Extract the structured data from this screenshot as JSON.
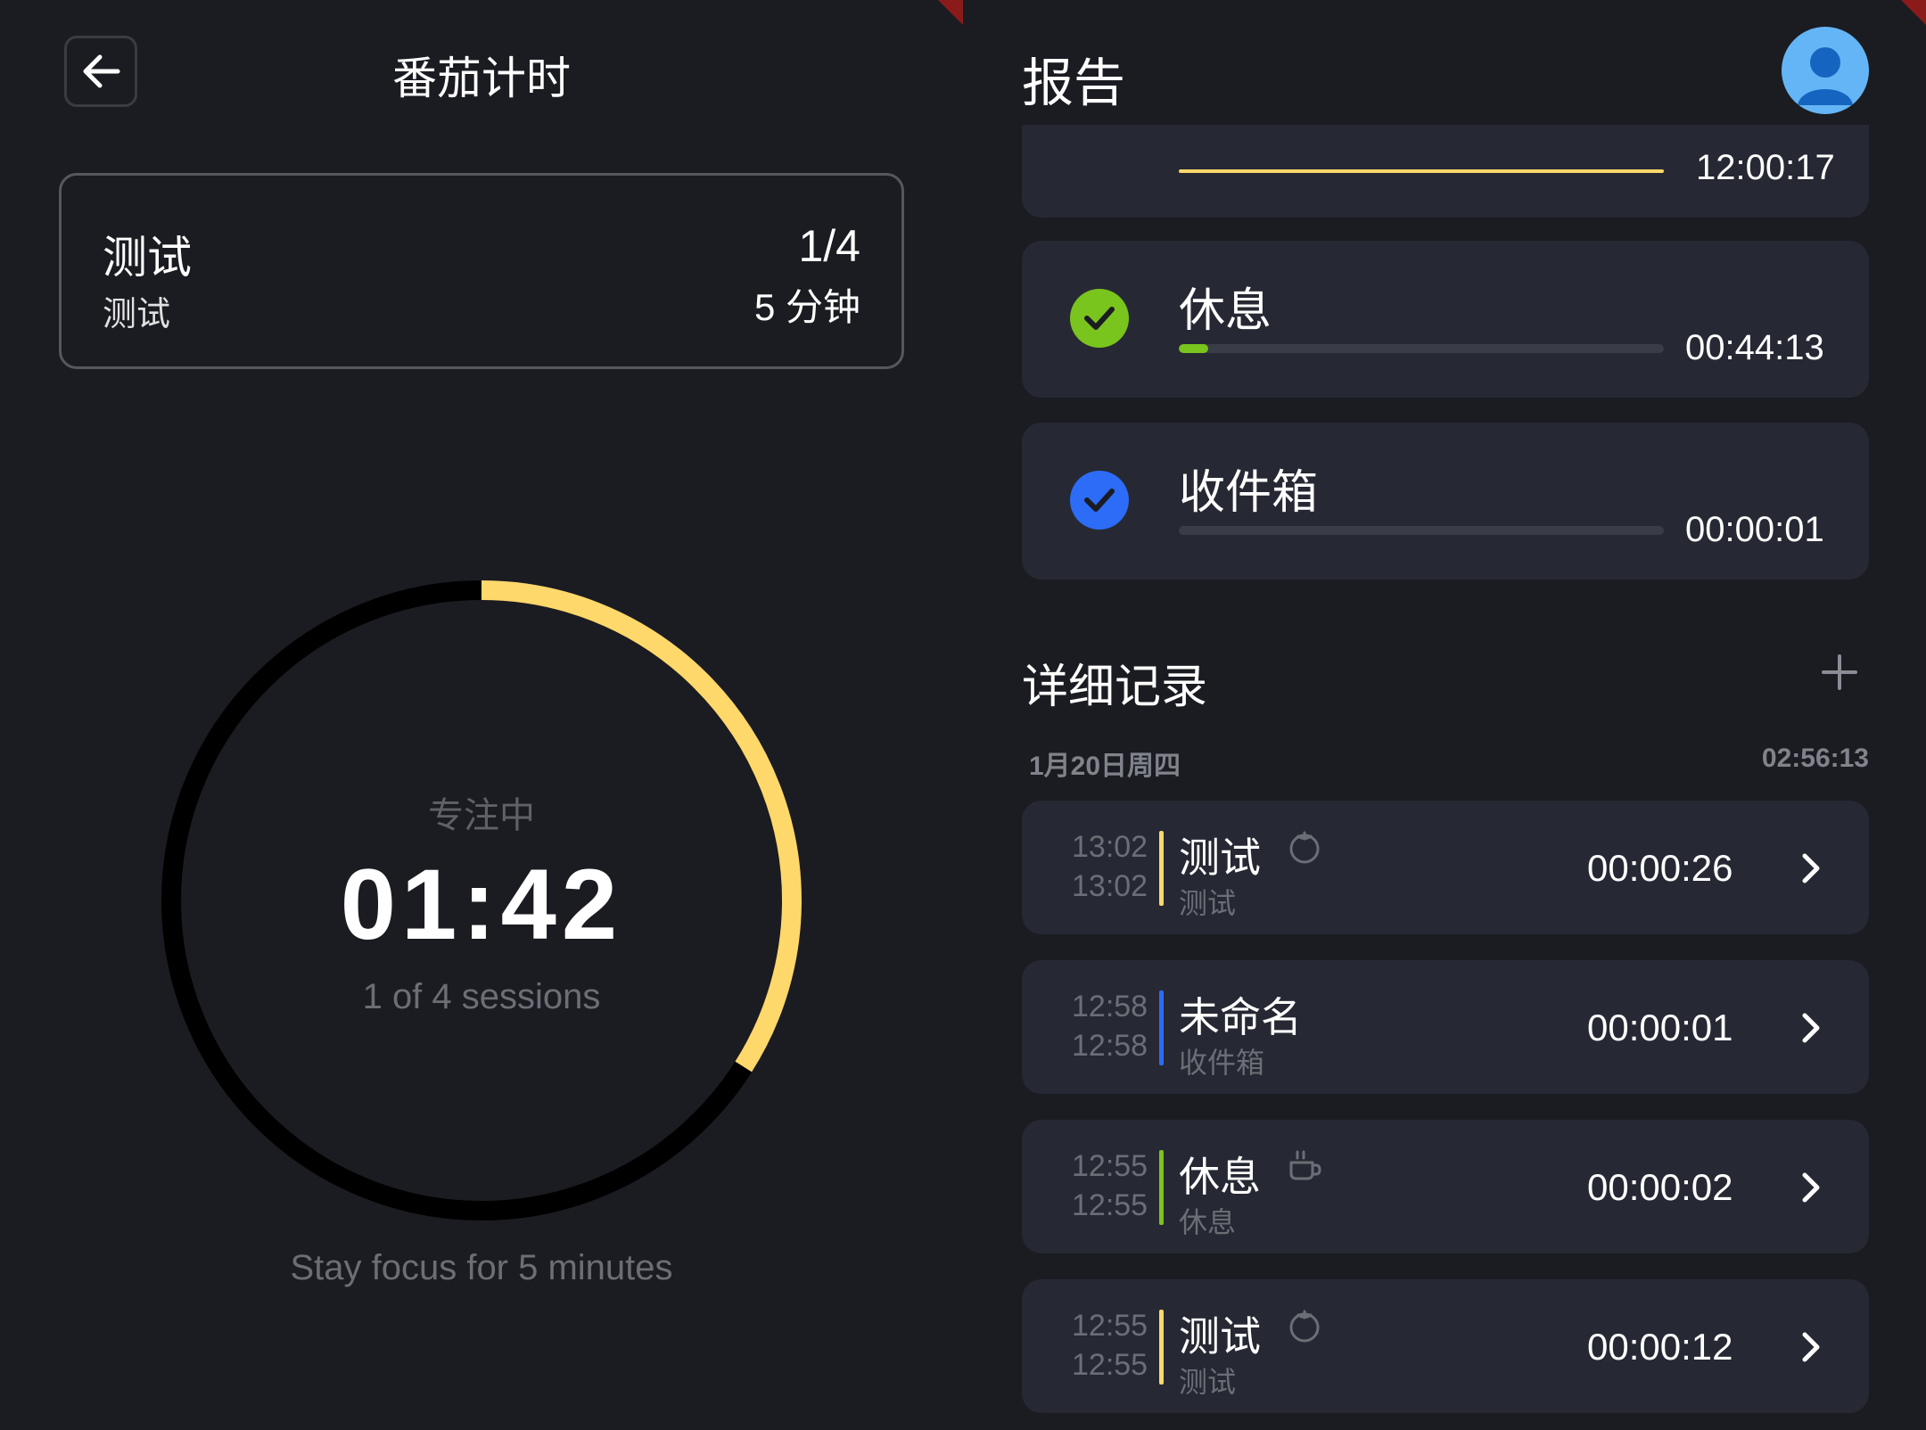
{
  "pomodoro": {
    "title": "番茄计时",
    "task": {
      "name": "测试",
      "category": "测试",
      "progress": "1/4",
      "duration": "5 分钟"
    },
    "timer": {
      "status": "专注中",
      "time": "01:42",
      "sessions": "1 of 4 sessions",
      "ring_fraction": 0.34
    },
    "hint": "Stay focus for 5 minutes",
    "colors": {
      "accent": "#ffd86b",
      "ring_track": "#000000",
      "background": "#1b1c22"
    }
  },
  "report": {
    "title": "报告",
    "avatar_icon": "user-avatar-icon",
    "partial_time": "12:00:17",
    "categories": [
      {
        "name": "休息",
        "time": "00:44:13",
        "color": "#7ac41e",
        "fill": 0.06
      },
      {
        "name": "收件箱",
        "time": "00:00:01",
        "color": "#2c6cf6",
        "fill": 0.0
      }
    ],
    "section_title": "详细记录",
    "date": "1月20日周四",
    "date_total": "02:56:13",
    "records": [
      {
        "start": "13:02",
        "end": "13:02",
        "name": "测试",
        "category": "测试",
        "icon": "tomato-icon",
        "duration": "00:00:26",
        "color": "#ffd86b"
      },
      {
        "start": "12:58",
        "end": "12:58",
        "name": "未命名",
        "category": "收件箱",
        "icon": "",
        "duration": "00:00:01",
        "color": "#2c6cf6"
      },
      {
        "start": "12:55",
        "end": "12:55",
        "name": "休息",
        "category": "休息",
        "icon": "coffee-cup-icon",
        "duration": "00:00:02",
        "color": "#7ac41e"
      },
      {
        "start": "12:55",
        "end": "12:55",
        "name": "测试",
        "category": "测试",
        "icon": "tomato-icon",
        "duration": "00:00:12",
        "color": "#ffd86b"
      }
    ]
  }
}
